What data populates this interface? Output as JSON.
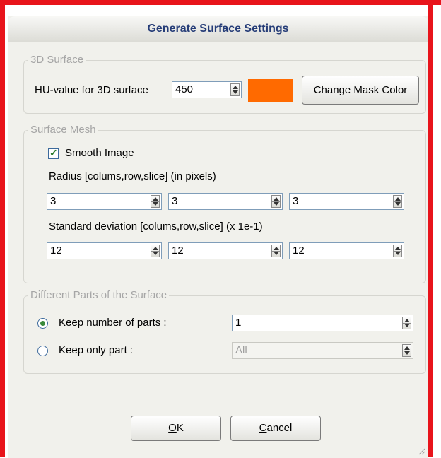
{
  "dialog": {
    "title": "Generate Surface Settings"
  },
  "surface3d": {
    "legend": "3D Surface",
    "hu_label": "HU-value for 3D surface",
    "hu_value": "450",
    "mask_color": "#ff6a00",
    "change_mask_color_label": "Change Mask Color"
  },
  "mesh": {
    "legend": "Surface Mesh",
    "smooth_label": "Smooth Image",
    "smooth_checked": true,
    "radius_label": "Radius [colums,row,slice] (in pixels)",
    "radius_values": [
      "3",
      "3",
      "3"
    ],
    "stddev_label": "Standard deviation [colums,row,slice] (x 1e-1)",
    "stddev_values": [
      "12",
      "12",
      "12"
    ]
  },
  "parts": {
    "legend": "Different Parts of the Surface",
    "keep_number_label": "Keep number of parts :",
    "keep_number_value": "1",
    "keep_only_label": "Keep only part :",
    "keep_only_value": "All",
    "selected_option": "keep_number"
  },
  "buttons": {
    "ok_hotkey": "O",
    "ok_rest": "K",
    "cancel_hotkey": "C",
    "cancel_rest": "ancel"
  }
}
